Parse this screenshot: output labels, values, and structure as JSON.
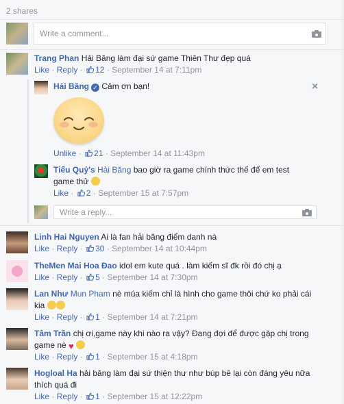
{
  "shares": "2 shares",
  "composer": {
    "placeholder": "Write a comment..."
  },
  "reply_composer": {
    "placeholder": "Write a reply..."
  },
  "actions": {
    "like": "Like",
    "unlike": "Unlike",
    "reply": "Reply",
    "sep": "·"
  },
  "comments": [
    {
      "name": "Trang Phan",
      "text": "Hải Băng làm đại sứ game Thiên Thư đẹp quá",
      "likes": "12",
      "date": "September 14 at 7:11pm"
    },
    {
      "name": "Linh Hai Nguyen",
      "text": "Ai là fan hải băng điểm danh nà",
      "likes": "30",
      "date": "September 14 at 10:44pm"
    },
    {
      "name": "TheMen Mai Hoa Đao",
      "text": "idol em kute quá . làm kiếm sĩ đk rồi đó chị ạ",
      "likes": "5",
      "date": "September 14 at 7:30pm"
    },
    {
      "name": "Lan Như",
      "mention": "Mun Pham",
      "text": "nè múa kiếm chỉ là hình cho game thôi chứ ko phải cái",
      "text2": "kia",
      "likes": "1",
      "date": "September 14 at 7:21pm"
    },
    {
      "name": "Tâm Trần",
      "text": "chị ơi,game này khi nào ra vậy? Đang đợi để được gặp chị trong",
      "text2": "game nè",
      "likes": "1",
      "date": "September 15 at 4:18pm"
    },
    {
      "name": "Hogloal Ha",
      "text": "hải băng làm đại sứ thiện thư như búp bê lại còn đáng yêu nữa",
      "text2": "thích quá đi",
      "likes": "1",
      "date": "September 15 at 12:22pm"
    }
  ],
  "replies": [
    {
      "name": "Hải Băng",
      "verified": true,
      "text": "Cảm ơn bạn!",
      "likes": "21",
      "date": "September 14 at 11:43pm"
    },
    {
      "name": "Tiểu Quỷ's",
      "mention": "Hải Băng",
      "text": "bao giờ ra game chính thức thế để em test",
      "text2": "game thử",
      "likes": "2",
      "date": "September 15 at 7:57pm"
    }
  ],
  "colors": {
    "link": "#4267b2",
    "muted": "#90949c",
    "bg": "#f6f7f9"
  },
  "icons": {
    "camera": "camera-icon",
    "like": "thumbs-up-icon",
    "close": "close-icon",
    "verified": "verified-badge-icon"
  }
}
